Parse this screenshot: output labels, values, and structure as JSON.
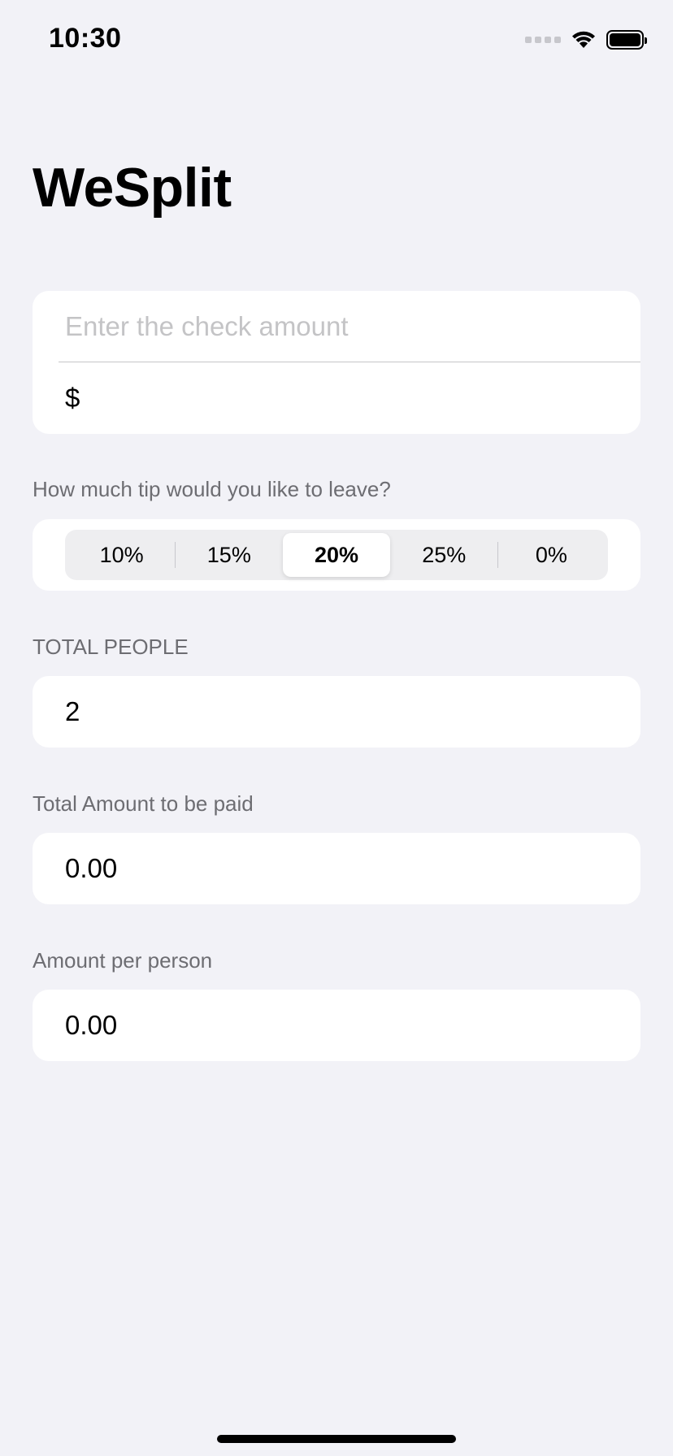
{
  "status_bar": {
    "time": "10:30",
    "icons": [
      "cellular-signal-icon",
      "wifi-icon",
      "battery-icon"
    ]
  },
  "title": "WeSplit",
  "check_amount": {
    "placeholder": "Enter the check amount",
    "currency_prefix": "$"
  },
  "tip": {
    "header": "How much tip would you like to leave?",
    "options": [
      "10%",
      "15%",
      "20%",
      "25%",
      "0%"
    ],
    "selected": "20%"
  },
  "people": {
    "header": "TOTAL PEOPLE",
    "value": "2"
  },
  "total": {
    "header": "Total Amount to be paid",
    "value": "0.00"
  },
  "per_person": {
    "header": "Amount per person",
    "value": "0.00"
  },
  "colors": {
    "background": "#f2f2f7",
    "card": "#ffffff",
    "secondary_text": "#6d6d72",
    "placeholder": "#c4c4c6"
  }
}
